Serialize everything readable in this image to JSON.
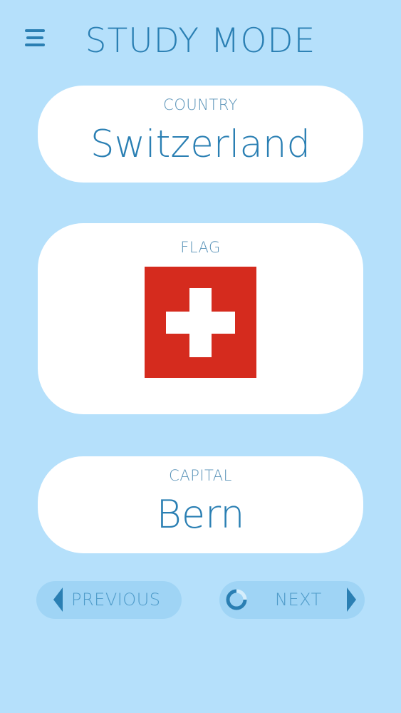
{
  "header": {
    "title": "STUDY MODE",
    "menu_icon": "hamburger-menu-icon"
  },
  "country_card": {
    "label": "COUNTRY",
    "value": "Switzerland"
  },
  "flag_card": {
    "label": "FLAG",
    "flag_colors": {
      "background": "#d52b1e",
      "cross": "#ffffff"
    }
  },
  "capital_card": {
    "label": "CAPITAL",
    "value": "Bern"
  },
  "navigation": {
    "previous_label": "PREVIOUS",
    "next_label": "NEXT",
    "previous_icon": "arrow-left-icon",
    "next_icon": "arrow-right-icon",
    "timer_icon": "progress-ring-icon"
  },
  "colors": {
    "background": "#b5e0fb",
    "card": "#ffffff",
    "accent": "#2a7fb3",
    "button": "#9fd4f5"
  }
}
